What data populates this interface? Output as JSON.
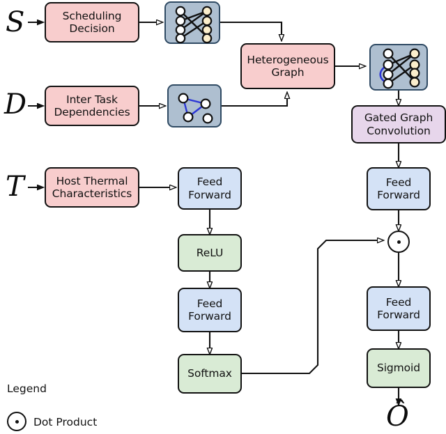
{
  "figure": {
    "type": "diagram",
    "title": "",
    "background": "#ffffff"
  },
  "colors": {
    "pink": "#f8cdcd",
    "blue": "#d4e2f6",
    "green": "#d9ebd5",
    "purple": "#e7d6eb",
    "graph_panel": "#aebfd0",
    "graph_panel_border": "#2f4a63",
    "node_white": "#ffffff",
    "node_cream": "#fbeecc",
    "edge_black": "#101010",
    "edge_blue": "#2b35d6",
    "stroke": "#101010"
  },
  "inputs": [
    {
      "name": "scheduling-decision-input",
      "symbol": "S"
    },
    {
      "name": "inter-task-dependencies-input",
      "symbol": "D"
    },
    {
      "name": "host-thermal-input",
      "symbol": "T"
    }
  ],
  "output": {
    "name": "predicted-output",
    "symbol": "Ô"
  },
  "blocks": [
    {
      "id": "scheduling_decision",
      "label": "Scheduling\nDecision",
      "line1": "Scheduling",
      "line2": "Decision",
      "color": "pink"
    },
    {
      "id": "inter_task_dependencies",
      "label": "Inter Task\nDependencies",
      "line1": "Inter Task",
      "line2": "Dependencies",
      "color": "pink"
    },
    {
      "id": "host_thermal",
      "label": "Host Thermal\nCharacteristics",
      "line1": "Host Thermal",
      "line2": "Characteristics",
      "color": "pink"
    },
    {
      "id": "heterogeneous_graph",
      "label": "Heterogeneous\nGraph",
      "line1": "Heterogeneous",
      "line2": "Graph",
      "color": "pink"
    },
    {
      "id": "gated_graph_convolution",
      "label": "Gated Graph\nConvolution",
      "line1": "Gated Graph",
      "line2": "Convolution",
      "color": "purple"
    },
    {
      "id": "feed_forward_right_top",
      "label": "Feed\nForward",
      "line1": "Feed",
      "line2": "Forward",
      "color": "blue"
    },
    {
      "id": "feed_forward_right_bottom",
      "label": "Feed\nForward",
      "line1": "Feed",
      "line2": "Forward",
      "color": "blue"
    },
    {
      "id": "feed_forward_mid_top",
      "label": "Feed\nForward",
      "line1": "Feed",
      "line2": "Forward",
      "color": "blue"
    },
    {
      "id": "feed_forward_mid_bottom",
      "label": "Feed\nForward",
      "line1": "Feed",
      "line2": "Forward",
      "color": "blue"
    },
    {
      "id": "relu",
      "label": "ReLU",
      "line1": "ReLU",
      "line2": "",
      "color": "green"
    },
    {
      "id": "softmax",
      "label": "Softmax",
      "line1": "Softmax",
      "line2": "",
      "color": "green"
    },
    {
      "id": "sigmoid",
      "label": "Sigmoid",
      "line1": "Sigmoid",
      "line2": "",
      "color": "green"
    }
  ],
  "graph_panels": [
    {
      "id": "bipartite_graph",
      "description": "bipartite graph of four white task nodes linked to four cream host nodes"
    },
    {
      "id": "dependency_graph",
      "description": "four white task nodes with three blue dependency edges forming a triangle"
    },
    {
      "id": "heterogeneous_graph_panel",
      "description": "combined graph with black bipartite edges and blue dependency edges"
    }
  ],
  "operators": [
    {
      "id": "dot_product_op",
      "symbol": "·",
      "name": "dot-product-operator"
    }
  ],
  "legend": {
    "title": "Legend",
    "entries": [
      {
        "symbol": "dot-product-icon",
        "label": "Dot Product"
      }
    ]
  }
}
